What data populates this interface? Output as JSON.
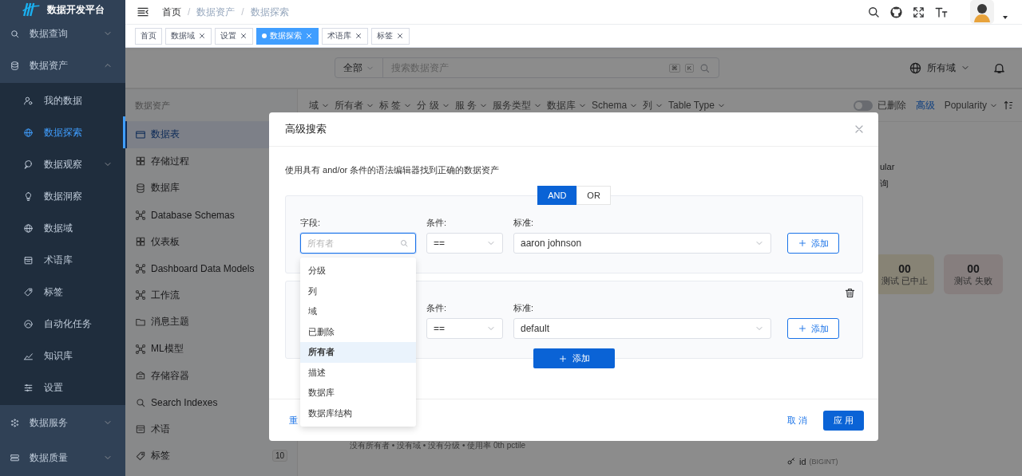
{
  "sidebar": {
    "logo_text": "数据开发平台",
    "items": [
      {
        "label": "数据查询",
        "expanded": false
      },
      {
        "label": "数据资产",
        "expanded": true,
        "children": [
          {
            "label": "我的数据",
            "selected": false,
            "expandable": false
          },
          {
            "label": "数据探索",
            "selected": true,
            "expandable": false
          },
          {
            "label": "数据观察",
            "selected": false,
            "expandable": true
          },
          {
            "label": "数据洞察",
            "selected": false,
            "expandable": false
          },
          {
            "label": "数据域",
            "selected": false,
            "expandable": false
          },
          {
            "label": "术语库",
            "selected": false,
            "expandable": false
          },
          {
            "label": "标签",
            "selected": false,
            "expandable": false
          },
          {
            "label": "自动化任务",
            "selected": false,
            "expandable": false
          },
          {
            "label": "知识库",
            "selected": false,
            "expandable": false
          },
          {
            "label": "设置",
            "selected": false,
            "expandable": false
          }
        ]
      },
      {
        "label": "数据服务",
        "expanded": false
      },
      {
        "label": "数据质量",
        "expanded": false
      }
    ]
  },
  "breadcrumb": {
    "separator": "/",
    "items": [
      {
        "label": "首页",
        "link": true
      },
      {
        "label": "数据资产",
        "link": false
      },
      {
        "label": "数据探索",
        "link": false
      }
    ]
  },
  "tabs": [
    {
      "label": "首页",
      "selected": false,
      "closable": false
    },
    {
      "label": "数据域",
      "selected": false,
      "closable": true
    },
    {
      "label": "设置",
      "selected": false,
      "closable": true
    },
    {
      "label": "数据探索",
      "selected": true,
      "closable": true
    },
    {
      "label": "术语库",
      "selected": false,
      "closable": true
    },
    {
      "label": "标签",
      "selected": false,
      "closable": true
    }
  ],
  "search": {
    "scope": "全部",
    "placeholder": "搜索数据资产",
    "shortcut_keys": [
      "⌘",
      "K"
    ],
    "domain": "所有域"
  },
  "filters": [
    "域",
    "所有者",
    "标 签",
    "分 级",
    "服 务",
    "服务类型",
    "数据库",
    "Schema",
    "列",
    "Table Type"
  ],
  "deleted_toggle": {
    "label": "已删除",
    "on": false
  },
  "advanced_link": "高级",
  "sort": "Popularity",
  "asset_panel": {
    "title": "数据资产",
    "items": [
      {
        "label": "数据表",
        "selected": true
      },
      {
        "label": "存储过程",
        "selected": false
      },
      {
        "label": "数据库",
        "selected": false
      },
      {
        "label": "Database Schemas",
        "selected": false
      },
      {
        "label": "仪表板",
        "selected": false
      },
      {
        "label": "Dashboard Data Models",
        "selected": false
      },
      {
        "label": "工作流",
        "selected": false
      },
      {
        "label": "消息主题",
        "selected": false
      },
      {
        "label": "ML模型",
        "selected": false
      },
      {
        "label": "存储容器",
        "selected": false
      },
      {
        "label": "Search Indexes",
        "selected": false
      },
      {
        "label": "术语",
        "selected": false
      },
      {
        "label": "标签",
        "selected": false,
        "count": "10"
      }
    ]
  },
  "result_meta": "没有所有者 • 没有域 • 没有分级 • 使用率 0th pctile",
  "right_panel": {
    "texts": [
      "ular",
      "询"
    ],
    "cards": [
      {
        "value": "00",
        "label": "测试 已中止",
        "kind": "aborted"
      },
      {
        "value": "00",
        "label": "测试 失败",
        "kind": "failed"
      }
    ],
    "column": {
      "name": "id",
      "type": "(BIGINT)"
    }
  },
  "modal": {
    "title": "高级搜索",
    "description": "使用具有 and/or 条件的语法编辑器找到正确的数据资产",
    "operators": [
      {
        "label": "AND",
        "selected": true
      },
      {
        "label": "OR",
        "selected": false
      }
    ],
    "groups": [
      {
        "field": {
          "label": "字段:",
          "placeholder": "所有者",
          "focused": true
        },
        "condition": {
          "label": "条件:",
          "value": "=="
        },
        "criteria": {
          "label": "标准:",
          "value": "aaron johnson"
        },
        "add_label": "添加",
        "deletable": false
      },
      {
        "condition": {
          "label": "条件:",
          "value": "=="
        },
        "criteria": {
          "label": "标准:",
          "value": "default"
        },
        "add_label": "添加",
        "deletable": true
      }
    ],
    "add_group_label": "添加",
    "reset_link": "重",
    "cancel": "取 消",
    "apply": "应 用",
    "field_options": [
      {
        "label": "分级",
        "selected": false
      },
      {
        "label": "列",
        "selected": false
      },
      {
        "label": "域",
        "selected": false
      },
      {
        "label": "已删除",
        "selected": false
      },
      {
        "label": "所有者",
        "selected": true
      },
      {
        "label": "描述",
        "selected": false
      },
      {
        "label": "数据库",
        "selected": false
      },
      {
        "label": "数据库结构",
        "selected": false
      }
    ]
  }
}
